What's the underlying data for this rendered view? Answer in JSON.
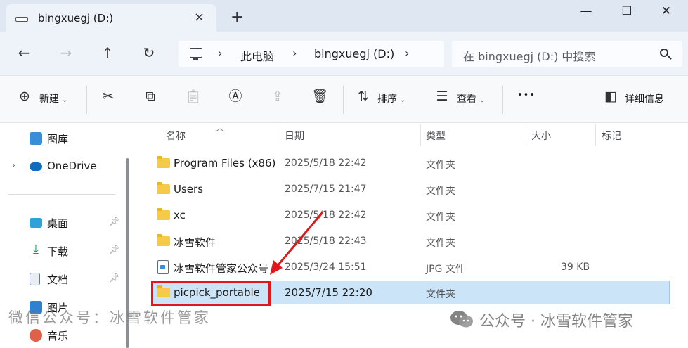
{
  "window": {
    "tab_title": "bingxuegj (D:)",
    "tab_close": "×",
    "new_tab": "+",
    "minimize": "—",
    "maximize": "☐",
    "close": "✕"
  },
  "navigation": {
    "back": "←",
    "forward": "→",
    "up": "↑",
    "refresh": "↻"
  },
  "address": {
    "crumbs": [
      "此电脑",
      "bingxuegj (D:)"
    ],
    "chevron": "›"
  },
  "search": {
    "placeholder": "在 bingxuegj (D:) 中搜索"
  },
  "toolbar": {
    "new_label": "新建",
    "sort_label": "排序",
    "view_label": "查看",
    "more_label": "•••",
    "details_label": "详细信息",
    "caret": "⌄"
  },
  "sidebar": {
    "items": [
      {
        "label": "图库",
        "icon": "gallery-icon",
        "color": "#3a8ed8"
      },
      {
        "label": "OneDrive",
        "icon": "onedrive-icon",
        "color": "#0f6cbd"
      },
      {
        "label": "桌面",
        "icon": "desktop-icon",
        "color": "#2ea1d6"
      },
      {
        "label": "下载",
        "icon": "download-icon",
        "color": "#1d8f5a"
      },
      {
        "label": "文档",
        "icon": "documents-icon",
        "color": "#6a7a94"
      },
      {
        "label": "图片",
        "icon": "pictures-icon",
        "color": "#2f80d1"
      },
      {
        "label": "音乐",
        "icon": "music-icon",
        "color": "#e0604a"
      }
    ]
  },
  "columns": {
    "name": "名称",
    "date": "日期",
    "type": "类型",
    "size": "大小",
    "tags": "标记"
  },
  "files": [
    {
      "name": "Program Files (x86)",
      "date": "2025/5/18 22:42",
      "type": "文件夹",
      "size": "",
      "kind": "folder"
    },
    {
      "name": "Users",
      "date": "2025/7/15 21:47",
      "type": "文件夹",
      "size": "",
      "kind": "folder"
    },
    {
      "name": "xc",
      "date": "2025/5/18 22:42",
      "type": "文件夹",
      "size": "",
      "kind": "folder"
    },
    {
      "name": "冰雪软件",
      "date": "2025/5/18 22:43",
      "type": "文件夹",
      "size": "",
      "kind": "folder"
    },
    {
      "name": "冰雪软件管家公众号",
      "date": "2025/3/24 15:51",
      "type": "JPG 文件",
      "size": "39 KB",
      "kind": "image"
    },
    {
      "name": "picpick_portable",
      "date": "2025/7/15 22:20",
      "type": "文件夹",
      "size": "",
      "kind": "folder",
      "selected": true
    }
  ],
  "watermark": {
    "left": "微信公众号：冰雪软件管家",
    "right": "公众号 · 冰雪软件管家"
  },
  "colors": {
    "selection": "#cce4f7",
    "annotation_red": "#e0181b",
    "folder_yellow": "#f7c948"
  }
}
